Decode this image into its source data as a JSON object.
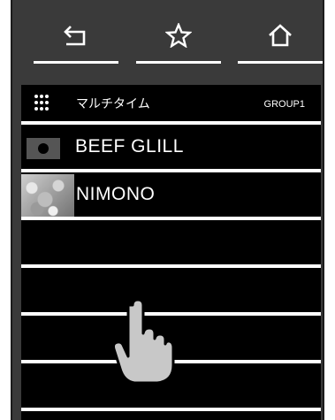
{
  "nav": {
    "back_icon": "back-arrow-icon",
    "favorite_icon": "star-icon",
    "home_icon": "home-icon"
  },
  "header": {
    "icon": "grid-icon",
    "title": "マルチタイム",
    "group": "GROUP1"
  },
  "list": {
    "items": [
      {
        "label": "BEEF GLILL",
        "icon": "camera-icon"
      },
      {
        "label": "NIMONO",
        "icon": "food-thumbnail"
      },
      {
        "label": ""
      },
      {
        "label": ""
      },
      {
        "label": ""
      },
      {
        "label": ""
      }
    ]
  },
  "overlay": {
    "icon": "pointing-hand-icon"
  },
  "colors": {
    "bezel": "#3a3a3a",
    "screen": "#000000",
    "divider": "#ffffff",
    "text": "#ffffff"
  }
}
